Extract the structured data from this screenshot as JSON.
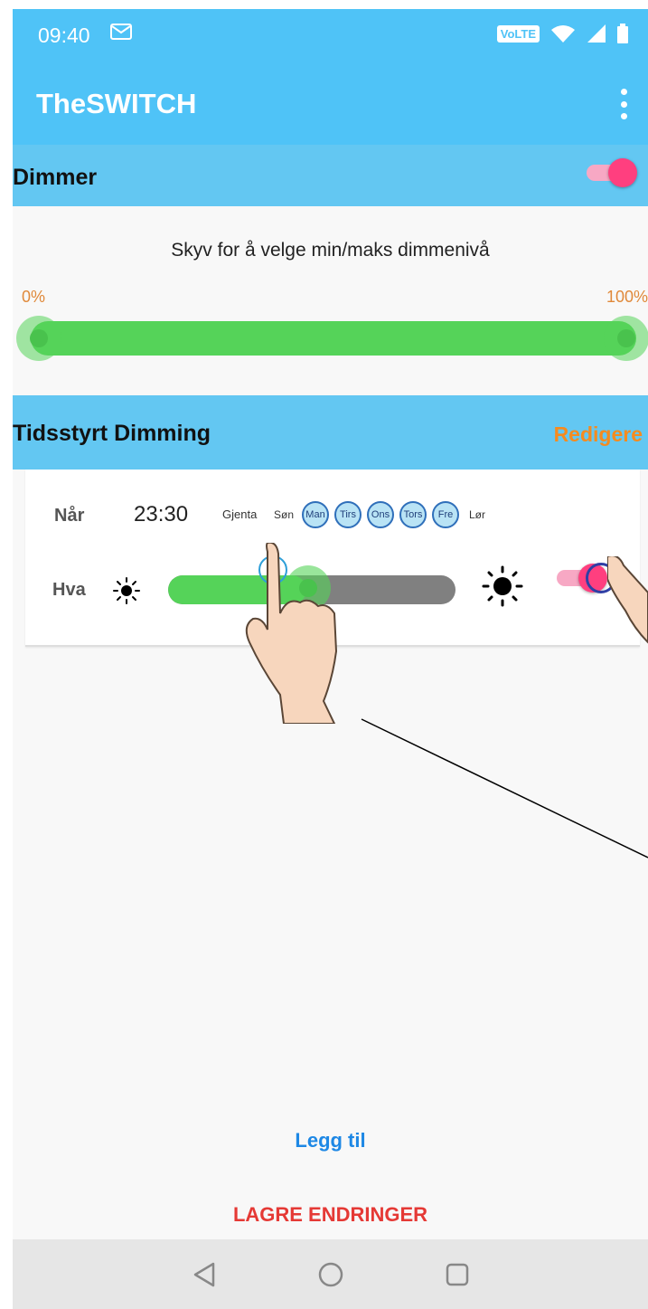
{
  "status_bar": {
    "time": "09:40",
    "volte": "VoLTE"
  },
  "app_bar": {
    "title": "TheSWITCH"
  },
  "dimmer": {
    "title": "Dimmer",
    "enabled": true,
    "hint": "Skyv for å velge min/maks dimmenivå",
    "min_label": "0%",
    "max_label": "100%"
  },
  "timed": {
    "title": "Tidsstyrt Dimming",
    "edit_label": "Redigere",
    "entry": {
      "when_label": "Når",
      "time": "23:30",
      "repeat_label": "Gjenta",
      "days": [
        {
          "label": "Søn",
          "active": false
        },
        {
          "label": "Man",
          "active": true
        },
        {
          "label": "Tirs",
          "active": true
        },
        {
          "label": "Ons",
          "active": true
        },
        {
          "label": "Tors",
          "active": true
        },
        {
          "label": "Fre",
          "active": true
        },
        {
          "label": "Lør",
          "active": false
        }
      ],
      "what_label": "Hva",
      "level_fraction": 0.48,
      "enabled": true
    }
  },
  "actions": {
    "add_label": "Legg til",
    "save_label": "LAGRE ENDRINGER"
  },
  "colors": {
    "primary": "#4fc3f7",
    "accent": "#ff3f7f",
    "edit": "#f58b1f",
    "slider": "#55d359",
    "add": "#1e88e5",
    "save": "#e53935"
  }
}
